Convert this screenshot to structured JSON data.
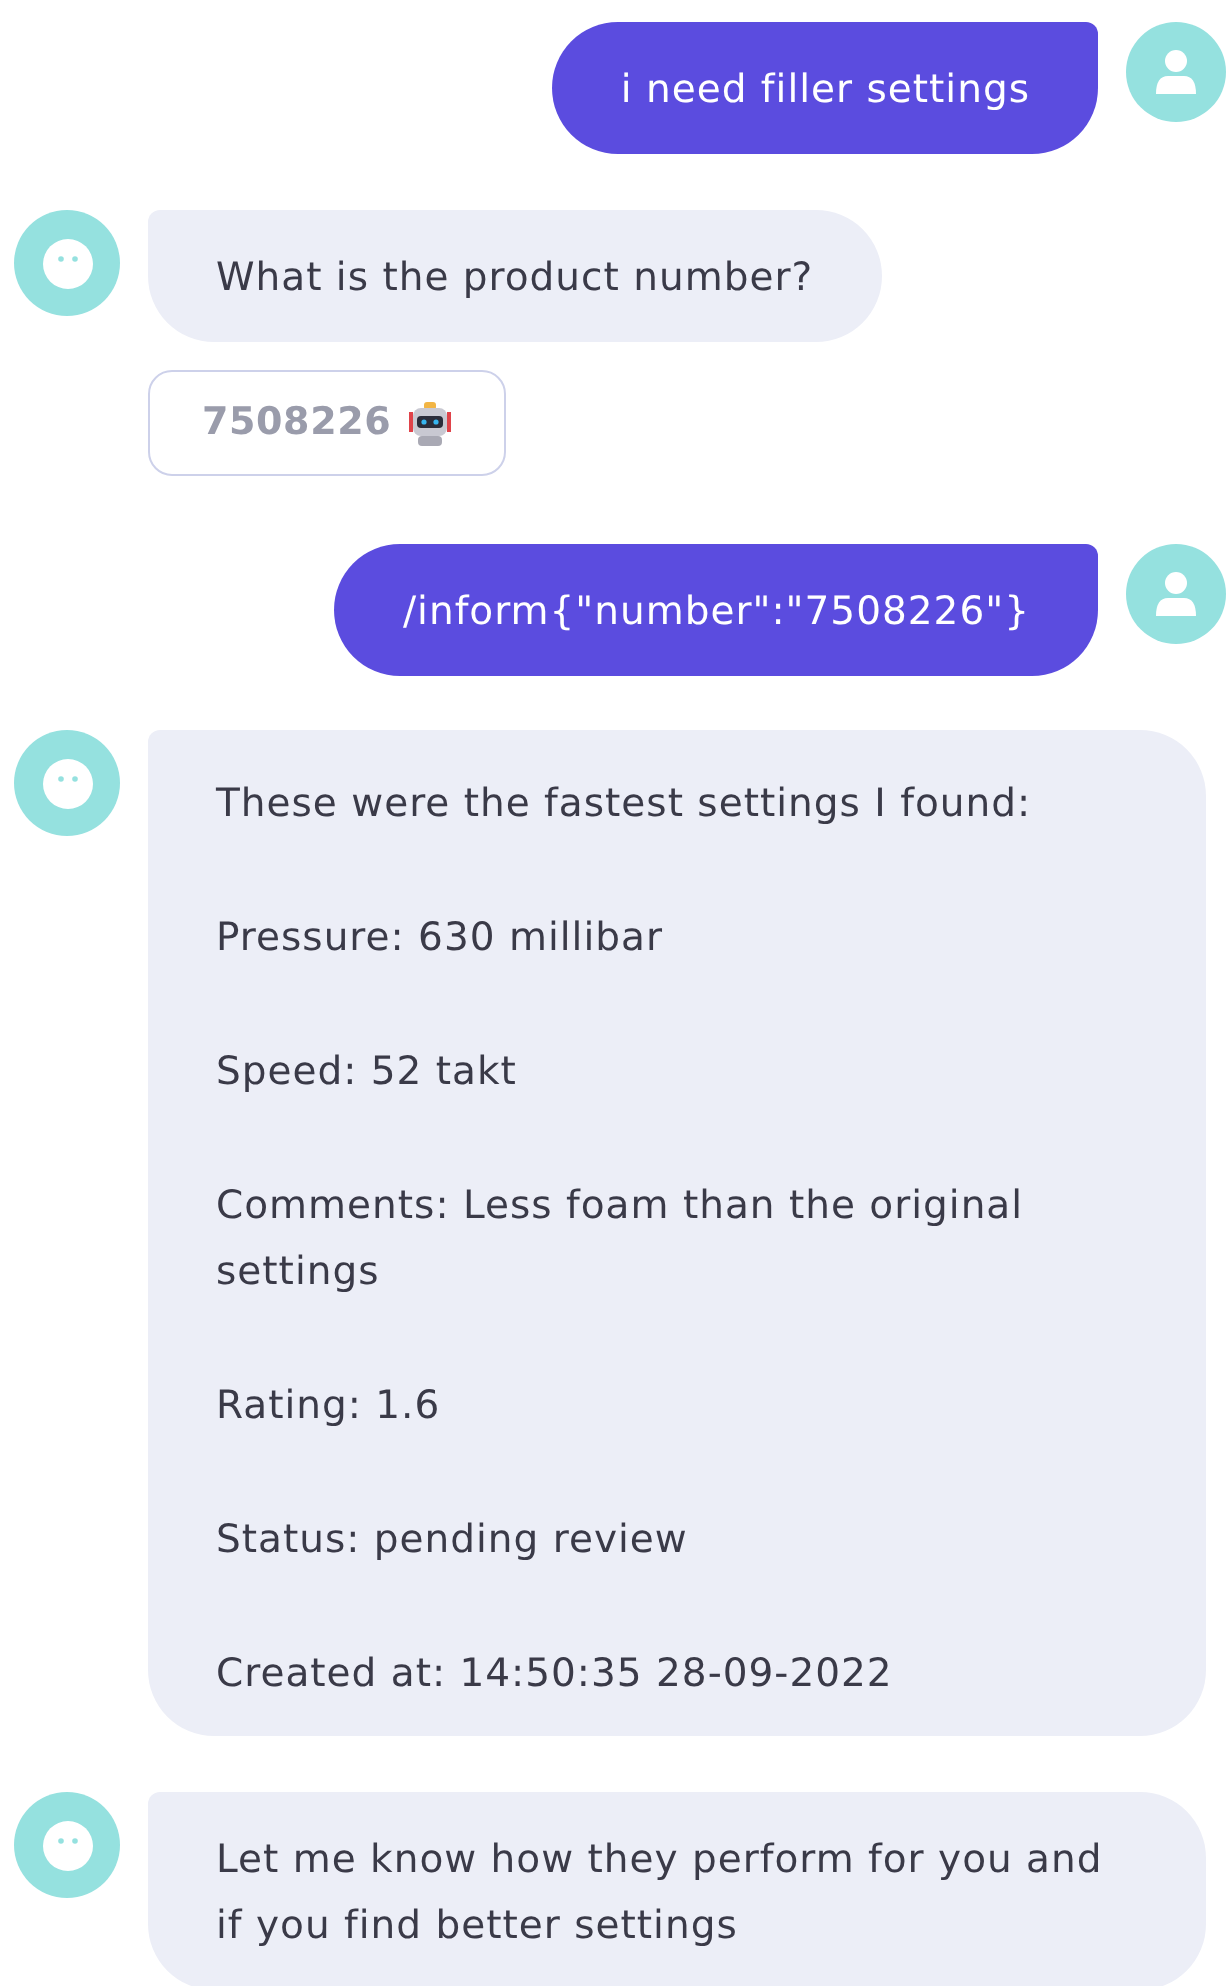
{
  "messages": [
    {
      "outgoing": true,
      "kind": "text",
      "text": "i need filler settings"
    },
    {
      "outgoing": false,
      "kind": "text",
      "text": "What is the product number?"
    },
    {
      "kind": "quick_replies",
      "buttons": [
        {
          "label": "7508226"
        }
      ]
    },
    {
      "outgoing": true,
      "kind": "text",
      "text": "/inform{\"number\":\"7508226\"}"
    },
    {
      "outgoing": false,
      "kind": "paragraphs",
      "lines": [
        "These were the fastest settings I found:",
        "Pressure: 630 millibar",
        "Speed: 52 takt",
        "Comments: Less foam than the original settings",
        "Rating: 1.6",
        "Status: pending review",
        "Created at: 14:50:35 28-09-2022"
      ]
    },
    {
      "outgoing": false,
      "kind": "text",
      "text": "Let me know how they perform for you and if you find better settings"
    }
  ]
}
